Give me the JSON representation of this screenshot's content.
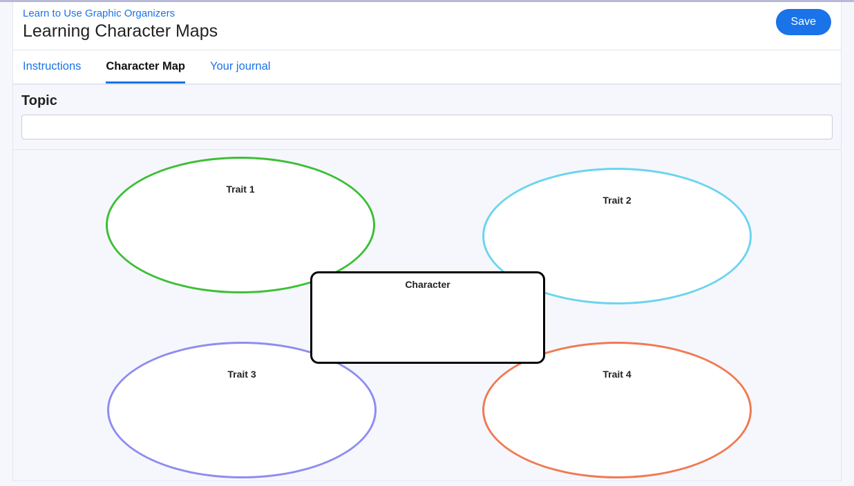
{
  "header": {
    "breadcrumb": "Learn to Use Graphic Organizers",
    "title": "Learning Character Maps",
    "save_label": "Save"
  },
  "tabs": {
    "instructions": "Instructions",
    "character_map": "Character Map",
    "journal": "Your journal",
    "active": "character_map"
  },
  "topic": {
    "label": "Topic",
    "value": ""
  },
  "diagram": {
    "center_label": "Character",
    "traits": {
      "t1": "Trait 1",
      "t2": "Trait 2",
      "t3": "Trait 3",
      "t4": "Trait 4"
    },
    "colors": {
      "t1": "#3dbf36",
      "t2": "#6bd4ef",
      "t3": "#8f8cf0",
      "t4": "#f07a52"
    }
  }
}
